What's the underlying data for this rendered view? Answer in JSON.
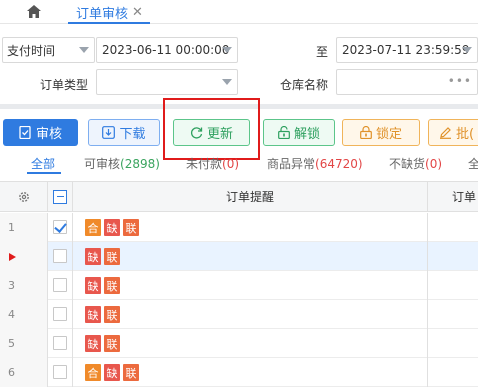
{
  "tabs": {
    "active_label": "订单审核",
    "close_glyph": "✕"
  },
  "filters": {
    "time_type": "支付时间",
    "start_time": "2023-06-11 00:00:00",
    "to_label": "至",
    "end_time": "2023-07-11 23:59:59",
    "order_type_label": "订单类型",
    "order_type_value": "",
    "warehouse_label": "仓库名称",
    "warehouse_value": "",
    "dots": "•••"
  },
  "toolbar": {
    "audit": "审核",
    "download": "下载",
    "update": "更新",
    "unlock": "解锁",
    "lock": "锁定",
    "batch": "批("
  },
  "filter_tabs": [
    {
      "label": "全部"
    },
    {
      "label": "可审核",
      "count": "(2898)"
    },
    {
      "label": "未付款",
      "count": "(0)"
    },
    {
      "label": "商品异常",
      "count": "(64720)"
    },
    {
      "label": "不缺货",
      "count": "(0)"
    },
    {
      "label": "全"
    }
  ],
  "table": {
    "headers": {
      "reminder": "订单提醒",
      "order_no": "订单"
    },
    "rows": [
      {
        "num": "1",
        "checked": true,
        "selected": false,
        "tags": [
          "合",
          "缺",
          "联"
        ]
      },
      {
        "num": "",
        "checked": false,
        "selected": true,
        "current": true,
        "tags": [
          "缺",
          "联"
        ]
      },
      {
        "num": "3",
        "checked": false,
        "selected": false,
        "tags": [
          "缺",
          "联"
        ]
      },
      {
        "num": "4",
        "checked": false,
        "selected": false,
        "tags": [
          "缺",
          "联"
        ]
      },
      {
        "num": "5",
        "checked": false,
        "selected": false,
        "tags": [
          "缺",
          "联"
        ]
      },
      {
        "num": "6",
        "checked": false,
        "selected": false,
        "tags": [
          "合",
          "缺",
          "联"
        ]
      }
    ]
  },
  "colors": {
    "primary": "#2f7be0",
    "success": "#2ea05f",
    "warning": "#e0922a",
    "highlight": "#e01b1b"
  },
  "icons": [
    "home-icon",
    "close-icon",
    "chevron-down-icon",
    "audit-icon",
    "download-icon",
    "refresh-icon",
    "unlock-icon",
    "lock-icon",
    "edit-icon",
    "settings-icon"
  ]
}
